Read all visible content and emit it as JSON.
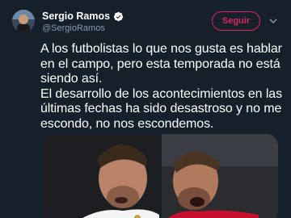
{
  "author": {
    "display_name": "Sergio Ramos",
    "handle": "@SergioRamos",
    "verified_icon": "verified-badge-icon",
    "avatar_icon": "avatar-photo"
  },
  "follow_button": {
    "label": "Seguir"
  },
  "menu_icon": "chevron-down-icon",
  "tweet": {
    "text": "A los futbolistas lo que nos gusta es hablar en el campo, pero esta temporada no está siendo así.\nEl desarrollo de los acontecimientos en las últimas fechas ha sido desastroso y no me escondo, no nos escondemos."
  },
  "media": {
    "photos": [
      {
        "icon": "player-photo-white-kit"
      },
      {
        "icon": "player-photo-red-kit"
      }
    ]
  },
  "colors": {
    "background": "#15202b",
    "accent": "#e0245e",
    "verified": "#1da1f2",
    "secondary_text": "#8899a6"
  }
}
